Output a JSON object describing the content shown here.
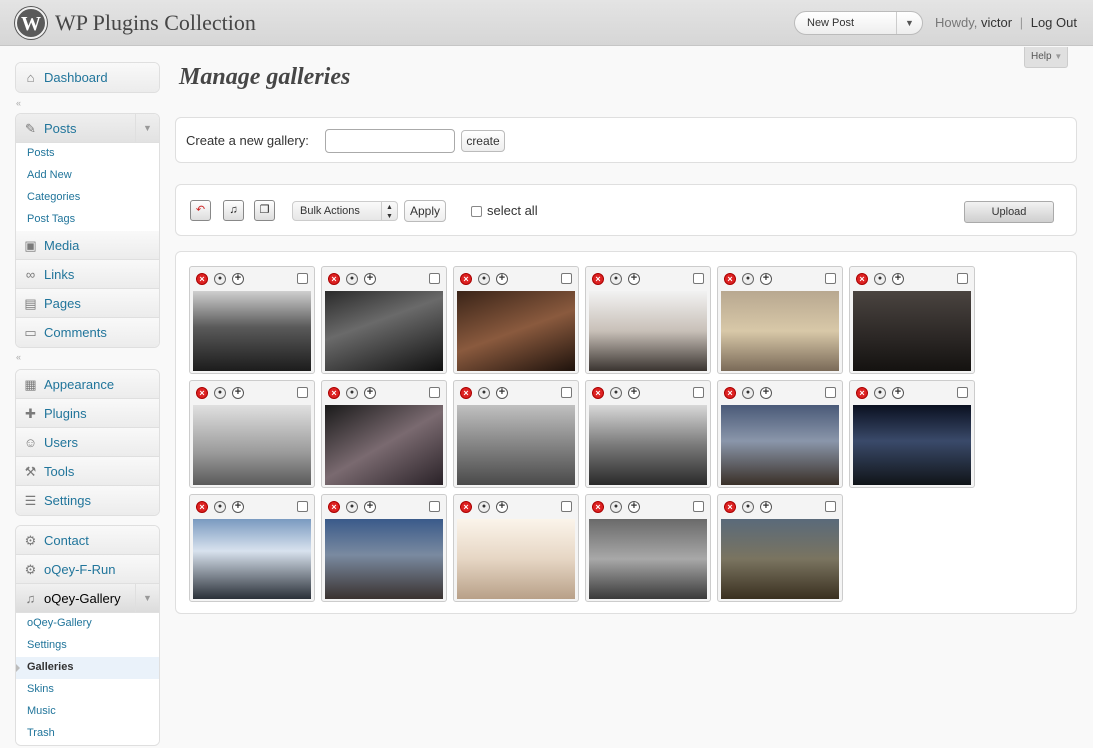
{
  "header": {
    "site_title": "WP Plugins Collection",
    "logo_letter": "W",
    "new_post": "New Post",
    "howdy": "Howdy,",
    "user": "victor",
    "separator": "|",
    "logout": "Log Out",
    "help": "Help"
  },
  "sidebar": {
    "dashboard": "Dashboard",
    "posts": {
      "label": "Posts",
      "items": [
        "Posts",
        "Add New",
        "Categories",
        "Post Tags"
      ]
    },
    "media": "Media",
    "links": "Links",
    "pages": "Pages",
    "comments": "Comments",
    "appearance": "Appearance",
    "plugins": "Plugins",
    "users": "Users",
    "tools": "Tools",
    "settings": "Settings",
    "contact": "Contact",
    "oqey_frun": "oQey-F-Run",
    "oqey_gallery": {
      "label": "oQey-Gallery",
      "items": [
        "oQey-Gallery",
        "Settings",
        "Galleries",
        "Skins",
        "Music",
        "Trash"
      ],
      "current": "Galleries"
    }
  },
  "main": {
    "title": "Manage galleries",
    "create_label": "Create a new gallery:",
    "create_input_value": "",
    "create_button": "create",
    "bulk_actions": "Bulk Actions",
    "apply": "Apply",
    "select_all": "select all",
    "upload": "Upload",
    "photo_count": 17
  },
  "colors": {
    "link": "#21759b",
    "header_bg": "#e4e4e4",
    "delete_icon": "#dd2222"
  },
  "icons": {
    "tile_delete": "delete-icon",
    "tile_set_cover": "set-cover-icon",
    "tile_view": "view-icon",
    "toolbar": [
      "restore-icon",
      "music-icon",
      "copy-icon"
    ]
  }
}
